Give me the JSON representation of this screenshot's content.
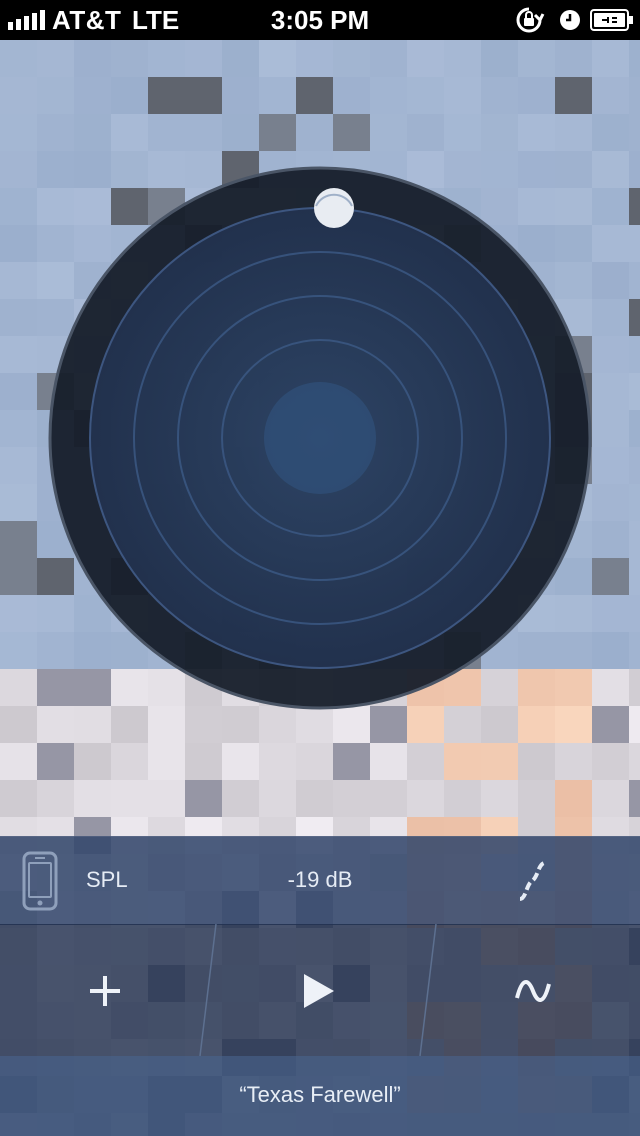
{
  "status_bar": {
    "carrier": "AT&T",
    "network": "LTE",
    "time": "3:05 PM",
    "icons": [
      "signal-bars-icon",
      "rotation-lock-icon",
      "alarm-clock-icon",
      "battery-charging-icon"
    ]
  },
  "meter": {
    "mode_label": "SPL",
    "level": "-19 dB"
  },
  "controls": {
    "add": "add-icon",
    "play": "play-icon",
    "wave": "waveform-icon"
  },
  "track": {
    "title": "“Texas Farewell”"
  },
  "colors": {
    "dial_outer": "#1b2332",
    "dial_inner": "#28395a",
    "panel": "#34486c",
    "accent_text": "#e6ecf5"
  }
}
